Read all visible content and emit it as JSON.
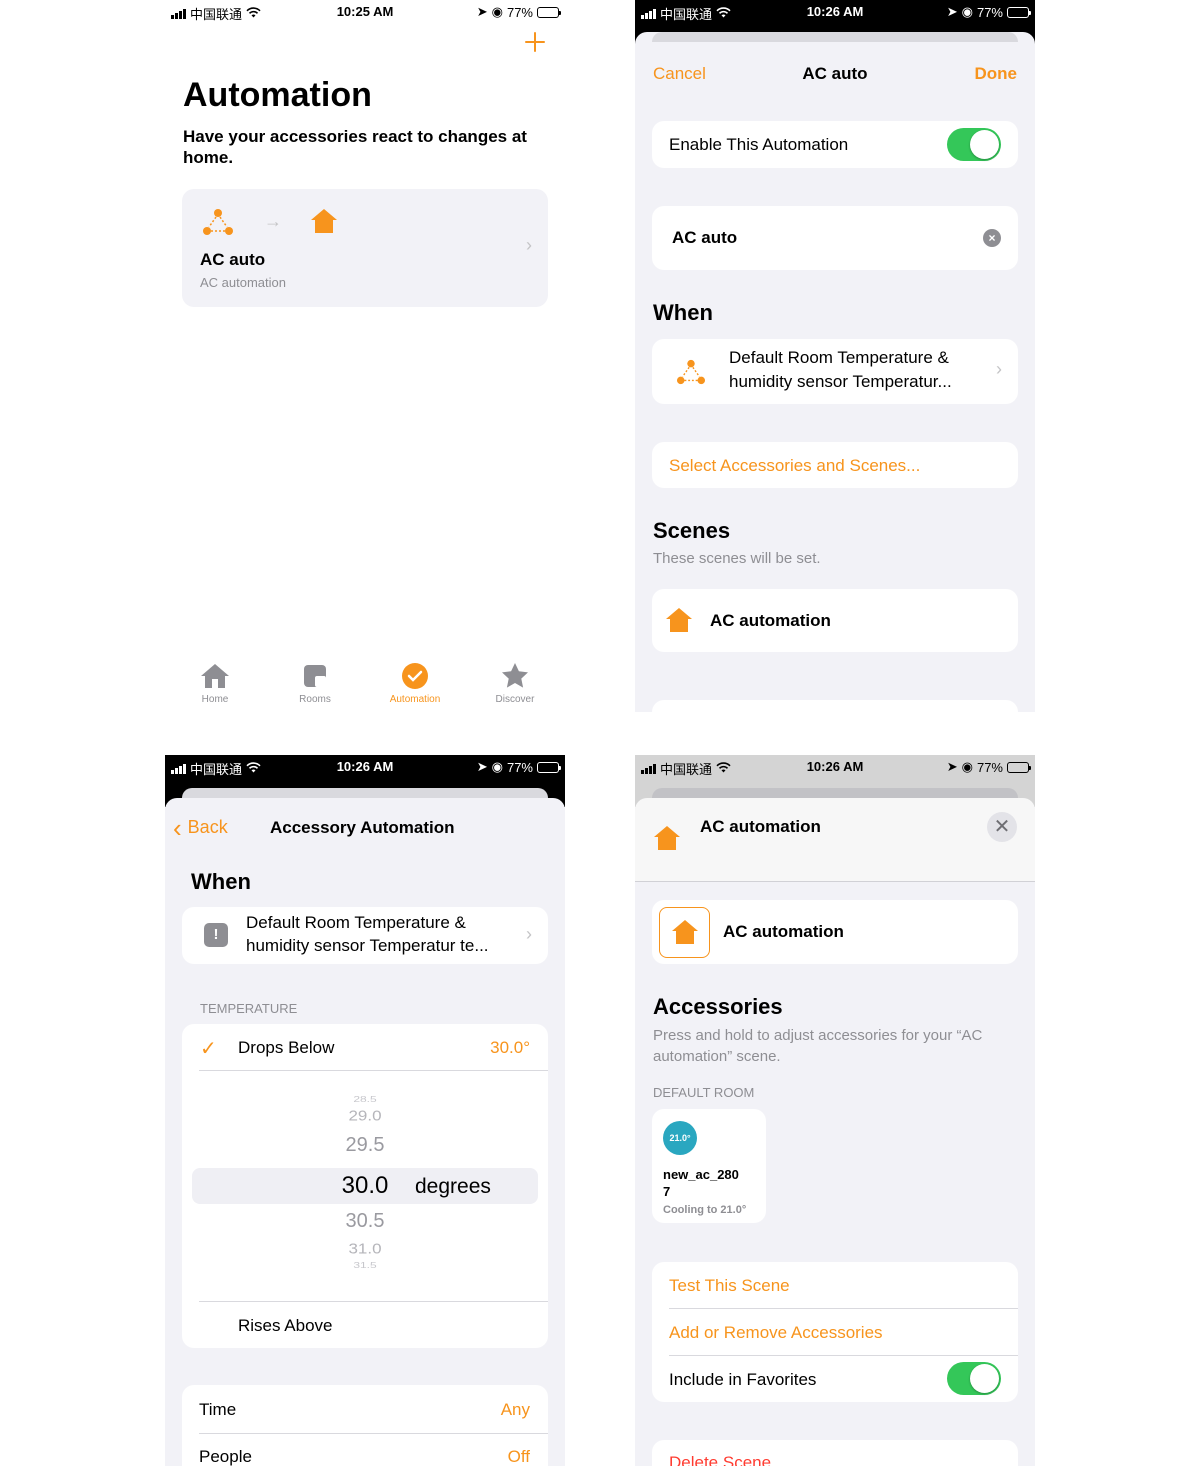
{
  "statusbar": {
    "carrier": "中国联通",
    "battery": "77%"
  },
  "screen1": {
    "time": "10:25 AM",
    "add_icon": "plus-icon",
    "title": "Automation",
    "subtitle": "Have your accessories react to changes at home.",
    "card": {
      "title": "AC auto",
      "subtitle": "AC automation"
    },
    "tabs": [
      {
        "label": "Home",
        "icon": "house-icon"
      },
      {
        "label": "Rooms",
        "icon": "rooms-icon"
      },
      {
        "label": "Automation",
        "icon": "automation-icon"
      },
      {
        "label": "Discover",
        "icon": "star-icon"
      }
    ]
  },
  "screen2": {
    "time": "10:26 AM",
    "cancel": "Cancel",
    "title": "AC auto",
    "done": "Done",
    "enable_label": "Enable This Automation",
    "enable_on": true,
    "name_value": "AC auto",
    "when_header": "When",
    "trigger_line1": "Default Room Temperature &",
    "trigger_line2": "humidity sensor Temperatur...",
    "select_link": "Select Accessories and Scenes...",
    "scenes_header": "Scenes",
    "scenes_caption": "These scenes will be set.",
    "scene_name": "AC automation"
  },
  "screen3": {
    "time": "10:26 AM",
    "back": "Back",
    "title": "Accessory Automation",
    "when_header": "When",
    "trigger_line1": "Default Room Temperature &",
    "trigger_line2": "humidity sensor Temperatur te...",
    "section_label": "TEMPERATURE",
    "drops_label": "Drops Below",
    "drops_value": "30.0°",
    "picker_values": [
      "28.5",
      "29.0",
      "29.5",
      "30.0",
      "30.5",
      "31.0",
      "31.5"
    ],
    "picker_unit": "degrees",
    "rises_label": "Rises Above",
    "time_label": "Time",
    "time_value": "Any",
    "people_label": "People",
    "people_value": "Off"
  },
  "screen4": {
    "time": "10:26 AM",
    "header_title": "AC automation",
    "scene_name": "AC automation",
    "accessories_header": "Accessories",
    "accessories_caption": "Press and hold to adjust accessories for your “AC automation” scene.",
    "room_label": "DEFAULT ROOM",
    "tile": {
      "badge": "21.0°",
      "name_line1": "new_ac_280",
      "name_line2": "7",
      "status": "Cooling to 21.0°"
    },
    "test_scene": "Test This Scene",
    "add_remove": "Add or Remove Accessories",
    "favorites_label": "Include in Favorites",
    "favorites_on": true,
    "delete_scene": "Delete Scene"
  },
  "colors": {
    "accent": "#f7941d",
    "toggle_on": "#34c759",
    "badge": "#2aa7c0"
  }
}
